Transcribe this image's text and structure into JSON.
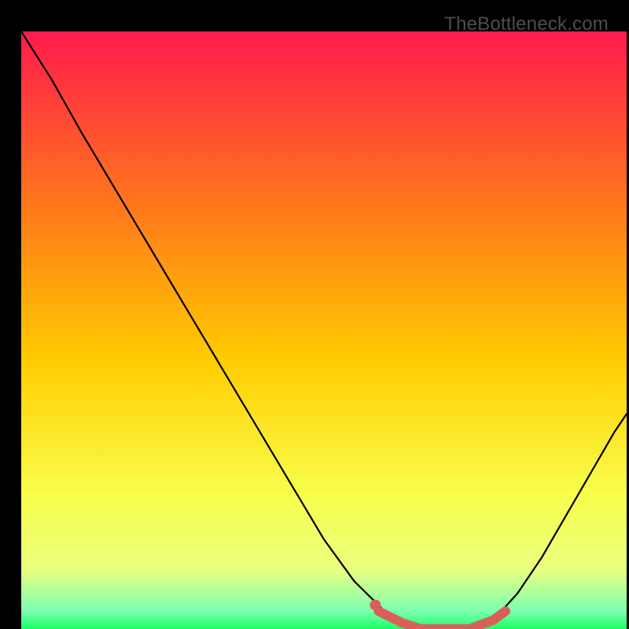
{
  "watermark": "TheBottleneck.com",
  "chart_data": {
    "type": "line",
    "title": "",
    "xlabel": "",
    "ylabel": "",
    "xlim": [
      0,
      100
    ],
    "ylim": [
      0,
      100
    ],
    "background_gradient": {
      "top": "#ff1a4d",
      "mid1": "#ff6633",
      "mid2": "#ffcc00",
      "mid3": "#ffff66",
      "bottom": "#1aff66"
    },
    "series": [
      {
        "name": "main-curve",
        "color": "#000000",
        "x": [
          0,
          5,
          10,
          15,
          20,
          25,
          30,
          35,
          40,
          45,
          50,
          55,
          60,
          63,
          66,
          70,
          74,
          78,
          82,
          86,
          90,
          94,
          98,
          100
        ],
        "y": [
          100,
          92,
          83,
          74.5,
          66,
          57.5,
          49,
          40.5,
          32,
          23.5,
          15,
          8,
          3,
          1,
          0,
          0,
          0,
          1.5,
          6,
          12,
          19,
          26,
          33,
          36
        ]
      },
      {
        "name": "highlight-segment",
        "color": "#d9605a",
        "x": [
          59,
          63,
          66,
          70,
          74,
          78,
          80
        ],
        "y": [
          3,
          1,
          0,
          0,
          0,
          1.5,
          3
        ]
      },
      {
        "name": "highlight-dot",
        "color": "#d9605a",
        "x": [
          58.5
        ],
        "y": [
          4
        ]
      }
    ]
  }
}
